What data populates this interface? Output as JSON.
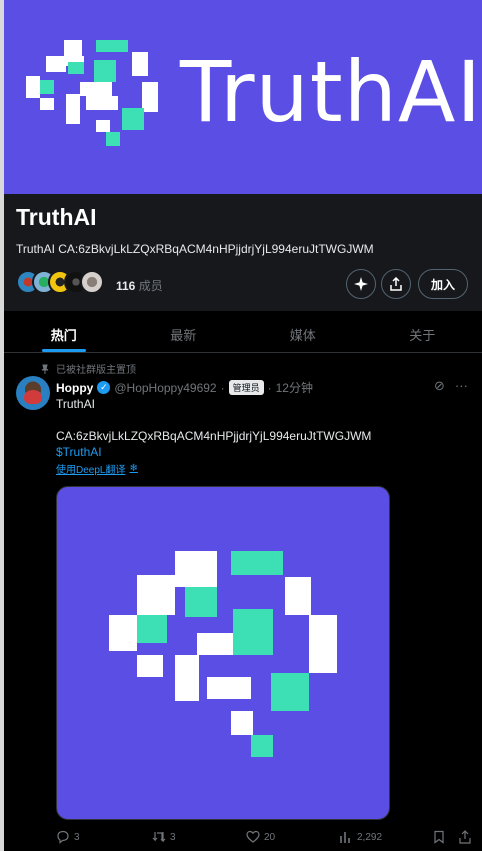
{
  "banner": {
    "title": "TruthAI"
  },
  "community": {
    "name": "TruthAI",
    "description": "TruthAI CA:6zBkvjLkLZQxRBqACM4nHPjjdrjYjL994eruJtTWGJWM",
    "member_count": "116",
    "member_label": "成员",
    "join_label": "加入"
  },
  "tabs": [
    "热门",
    "最新",
    "媒体",
    "关于"
  ],
  "post": {
    "pinned_label": "已被社群版主置顶",
    "display_name": "Hoppy",
    "handle": "@HopHoppy49692",
    "role_badge": "管理员",
    "time": "12分钟",
    "text_line1": "TruthAI",
    "text_line2": "CA:6zBkvjLkLZQxRBqACM4nHPjjdrjYjL994eruJtTWGJWM",
    "cashtag": "$TruthAI",
    "translate_label": "使用DeepL翻译",
    "replies": "3",
    "reposts": "3",
    "likes": "20",
    "views": "2,292"
  },
  "colors": {
    "brand_purple": "#5b4ee5",
    "accent": "#1d9bf0",
    "teal": "#3de0b5"
  }
}
